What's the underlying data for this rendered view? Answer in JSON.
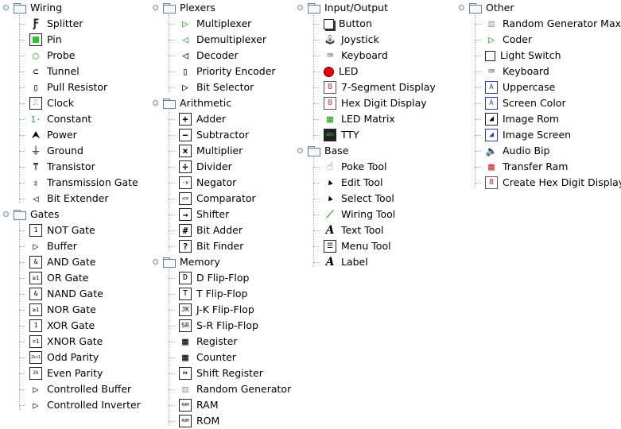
{
  "columns": [
    {
      "categories": [
        {
          "name": "Wiring",
          "items": [
            {
              "label": "Splitter",
              "icon": "splitter-icon"
            },
            {
              "label": "Pin",
              "icon": "pin-icon"
            },
            {
              "label": "Probe",
              "icon": "probe-icon"
            },
            {
              "label": "Tunnel",
              "icon": "tunnel-icon"
            },
            {
              "label": "Pull Resistor",
              "icon": "pull-resistor-icon"
            },
            {
              "label": "Clock",
              "icon": "clock-icon"
            },
            {
              "label": "Constant",
              "icon": "constant-icon"
            },
            {
              "label": "Power",
              "icon": "power-icon"
            },
            {
              "label": "Ground",
              "icon": "ground-icon"
            },
            {
              "label": "Transistor",
              "icon": "transistor-icon"
            },
            {
              "label": "Transmission Gate",
              "icon": "transmission-gate-icon"
            },
            {
              "label": "Bit Extender",
              "icon": "bit-extender-icon"
            }
          ]
        },
        {
          "name": "Gates",
          "items": [
            {
              "label": "NOT Gate",
              "icon": "not-gate-icon"
            },
            {
              "label": "Buffer",
              "icon": "buffer-icon"
            },
            {
              "label": "AND Gate",
              "icon": "and-gate-icon"
            },
            {
              "label": "OR Gate",
              "icon": "or-gate-icon"
            },
            {
              "label": "NAND Gate",
              "icon": "nand-gate-icon"
            },
            {
              "label": "NOR Gate",
              "icon": "nor-gate-icon"
            },
            {
              "label": "XOR Gate",
              "icon": "xor-gate-icon"
            },
            {
              "label": "XNOR Gate",
              "icon": "xnor-gate-icon"
            },
            {
              "label": "Odd Parity",
              "icon": "odd-parity-icon"
            },
            {
              "label": "Even Parity",
              "icon": "even-parity-icon"
            },
            {
              "label": "Controlled Buffer",
              "icon": "controlled-buffer-icon"
            },
            {
              "label": "Controlled Inverter",
              "icon": "controlled-inverter-icon"
            }
          ]
        }
      ]
    },
    {
      "categories": [
        {
          "name": "Plexers",
          "items": [
            {
              "label": "Multiplexer",
              "icon": "multiplexer-icon"
            },
            {
              "label": "Demultiplexer",
              "icon": "demultiplexer-icon"
            },
            {
              "label": "Decoder",
              "icon": "decoder-icon"
            },
            {
              "label": "Priority Encoder",
              "icon": "priority-encoder-icon"
            },
            {
              "label": "Bit Selector",
              "icon": "bit-selector-icon"
            }
          ]
        },
        {
          "name": "Arithmetic",
          "items": [
            {
              "label": "Adder",
              "icon": "adder-icon"
            },
            {
              "label": "Subtractor",
              "icon": "subtractor-icon"
            },
            {
              "label": "Multiplier",
              "icon": "multiplier-icon"
            },
            {
              "label": "Divider",
              "icon": "divider-icon"
            },
            {
              "label": "Negator",
              "icon": "negator-icon"
            },
            {
              "label": "Comparator",
              "icon": "comparator-icon"
            },
            {
              "label": "Shifter",
              "icon": "shifter-icon"
            },
            {
              "label": "Bit Adder",
              "icon": "bit-adder-icon"
            },
            {
              "label": "Bit Finder",
              "icon": "bit-finder-icon"
            }
          ]
        },
        {
          "name": "Memory",
          "items": [
            {
              "label": "D Flip-Flop",
              "icon": "d-flip-flop-icon"
            },
            {
              "label": "T Flip-Flop",
              "icon": "t-flip-flop-icon"
            },
            {
              "label": "J-K Flip-Flop",
              "icon": "jk-flip-flop-icon"
            },
            {
              "label": "S-R Flip-Flop",
              "icon": "sr-flip-flop-icon"
            },
            {
              "label": "Register",
              "icon": "register-icon"
            },
            {
              "label": "Counter",
              "icon": "counter-icon"
            },
            {
              "label": "Shift Register",
              "icon": "shift-register-icon"
            },
            {
              "label": "Random Generator",
              "icon": "random-generator-icon"
            },
            {
              "label": "RAM",
              "icon": "ram-icon"
            },
            {
              "label": "ROM",
              "icon": "rom-icon"
            }
          ]
        }
      ]
    },
    {
      "categories": [
        {
          "name": "Input/Output",
          "items": [
            {
              "label": "Button",
              "icon": "button-icon"
            },
            {
              "label": "Joystick",
              "icon": "joystick-icon"
            },
            {
              "label": "Keyboard",
              "icon": "keyboard-icon"
            },
            {
              "label": "LED",
              "icon": "led-icon"
            },
            {
              "label": "7-Segment Display",
              "icon": "seven-segment-icon"
            },
            {
              "label": "Hex Digit Display",
              "icon": "hex-digit-icon"
            },
            {
              "label": "LED Matrix",
              "icon": "led-matrix-icon"
            },
            {
              "label": "TTY",
              "icon": "tty-icon"
            }
          ]
        },
        {
          "name": "Base",
          "items": [
            {
              "label": "Poke Tool",
              "icon": "poke-tool-icon"
            },
            {
              "label": "Edit Tool",
              "icon": "edit-tool-icon"
            },
            {
              "label": "Select Tool",
              "icon": "select-tool-icon"
            },
            {
              "label": "Wiring Tool",
              "icon": "wiring-tool-icon"
            },
            {
              "label": "Text Tool",
              "icon": "text-tool-icon"
            },
            {
              "label": "Menu Tool",
              "icon": "menu-tool-icon"
            },
            {
              "label": "Label",
              "icon": "label-icon"
            }
          ]
        }
      ]
    },
    {
      "categories": [
        {
          "name": "Other",
          "items": [
            {
              "label": "Random Generator Max",
              "icon": "random-generator-max-icon"
            },
            {
              "label": "Coder",
              "icon": "coder-icon"
            },
            {
              "label": "Light Switch",
              "icon": "light-switch-icon"
            },
            {
              "label": "Keyboard",
              "icon": "keyboard-icon"
            },
            {
              "label": "Uppercase",
              "icon": "uppercase-icon"
            },
            {
              "label": "Screen Color",
              "icon": "screen-color-icon"
            },
            {
              "label": "Image Rom",
              "icon": "image-rom-icon"
            },
            {
              "label": "Image Screen",
              "icon": "image-screen-icon"
            },
            {
              "label": "Audio Bip",
              "icon": "audio-bip-icon"
            },
            {
              "label": "Transfer Ram",
              "icon": "transfer-ram-icon"
            },
            {
              "label": "Create Hex Digit Display",
              "icon": "create-hex-digit-icon"
            }
          ]
        }
      ]
    }
  ]
}
